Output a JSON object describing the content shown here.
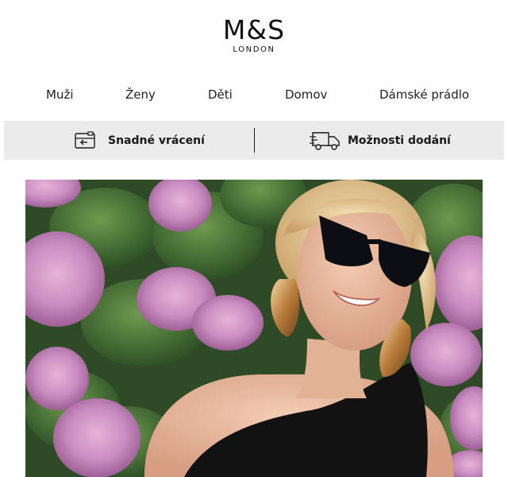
{
  "brand": {
    "name": "M&S",
    "subtitle": "LONDON"
  },
  "nav": {
    "items": [
      {
        "label": "Muži"
      },
      {
        "label": "Ženy"
      },
      {
        "label": "Děti"
      },
      {
        "label": "Domov"
      },
      {
        "label": "Dámské prádlo"
      }
    ]
  },
  "services": {
    "returns": {
      "label": "Snadné vrácení",
      "icon": "return-box-icon"
    },
    "delivery": {
      "label": "Možnosti dodání",
      "icon": "delivery-truck-icon"
    }
  },
  "hero": {
    "image": "woman-sunglasses-hydrangeas-photo"
  },
  "colors": {
    "service_bar_bg": "#ebebeb",
    "text": "#1a1a1a"
  }
}
